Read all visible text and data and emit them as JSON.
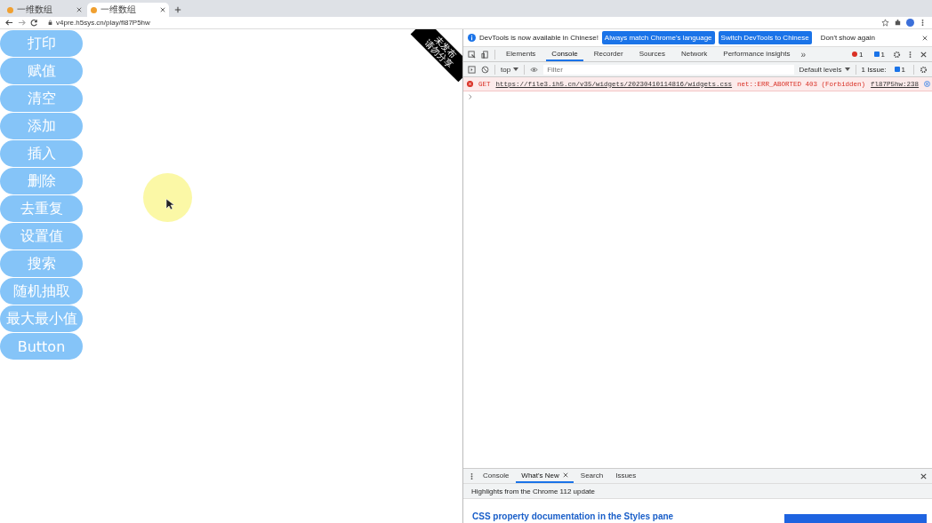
{
  "browser": {
    "tabs": [
      {
        "title": "一维数组",
        "selected": false
      },
      {
        "title": "一维数组",
        "selected": true
      }
    ],
    "url": "v4pre.h5sys.cn/play/fl87P5hw"
  },
  "page": {
    "buttons": [
      "打印",
      "赋值",
      "清空",
      "添加",
      "插入",
      "删除",
      "去重复",
      "设置值",
      "搜索",
      "随机抽取",
      "最大最小值",
      "Button"
    ],
    "ribbon": [
      "未发布",
      "请勿分享"
    ]
  },
  "devtools": {
    "infobar": {
      "message": "DevTools is now available in Chinese!",
      "actions": [
        "Always match Chrome's language",
        "Switch DevTools to Chinese"
      ],
      "dismiss": "Don't show again"
    },
    "tabs": [
      {
        "label": "Elements",
        "selected": false
      },
      {
        "label": "Console",
        "selected": true
      },
      {
        "label": "Recorder",
        "selected": false
      },
      {
        "label": "Sources",
        "selected": false
      },
      {
        "label": "Network",
        "selected": false
      },
      {
        "label": "Performance insights",
        "selected": false
      }
    ],
    "more_tabs": "»",
    "error_count": "1",
    "message_count": "1",
    "context": "top",
    "filter_placeholder": "Filter",
    "levels": "Default levels",
    "issues_label": "1 Issue:",
    "issues_count": "1",
    "error": {
      "method": "GET",
      "url": "https://file3.ih5.cn/v35/widgets/20230410114816/widgets.css",
      "status": "net::ERR_ABORTED 403 (Forbidden)",
      "source": "fl87P5hw:238"
    },
    "drawer": {
      "tabs": [
        {
          "label": "Console",
          "selected": false
        },
        {
          "label": "What's New",
          "selected": true
        },
        {
          "label": "Search",
          "selected": false
        },
        {
          "label": "Issues",
          "selected": false
        }
      ],
      "highlights": "Highlights from the Chrome 112 update",
      "heading": "CSS property documentation in the Styles pane"
    }
  }
}
